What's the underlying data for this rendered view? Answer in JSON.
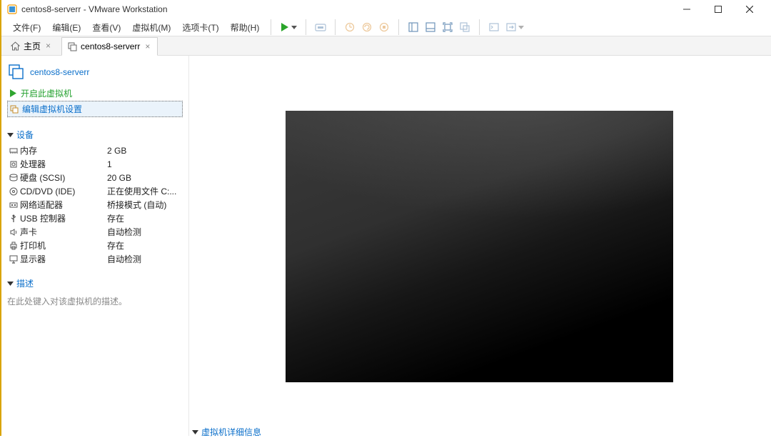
{
  "title_bar": {
    "text": "centos8-serverr - VMware Workstation"
  },
  "menu": [
    "文件(F)",
    "编辑(E)",
    "查看(V)",
    "虚拟机(M)",
    "选项卡(T)",
    "帮助(H)"
  ],
  "tabs": {
    "home": "主页",
    "vm": "centos8-serverr"
  },
  "vm": {
    "name": "centos8-serverr",
    "actions": {
      "power_on": "开启此虚拟机",
      "edit_settings": "编辑虚拟机设置"
    },
    "devices_title": "设备",
    "devices": [
      {
        "icon": "memory",
        "label": "内存",
        "value": "2 GB"
      },
      {
        "icon": "cpu",
        "label": "处理器",
        "value": "1"
      },
      {
        "icon": "disk",
        "label": "硬盘 (SCSI)",
        "value": "20 GB"
      },
      {
        "icon": "cd",
        "label": "CD/DVD (IDE)",
        "value": "正在使用文件 C:..."
      },
      {
        "icon": "net",
        "label": "网络适配器",
        "value": "桥接模式 (自动)"
      },
      {
        "icon": "usb",
        "label": "USB 控制器",
        "value": "存在"
      },
      {
        "icon": "sound",
        "label": "声卡",
        "value": "自动检测"
      },
      {
        "icon": "printer",
        "label": "打印机",
        "value": "存在"
      },
      {
        "icon": "display",
        "label": "显示器",
        "value": "自动检测"
      }
    ],
    "description_title": "描述",
    "description_placeholder": "在此处键入对该虚拟机的描述。",
    "detail_footer": "虚拟机详细信息"
  }
}
